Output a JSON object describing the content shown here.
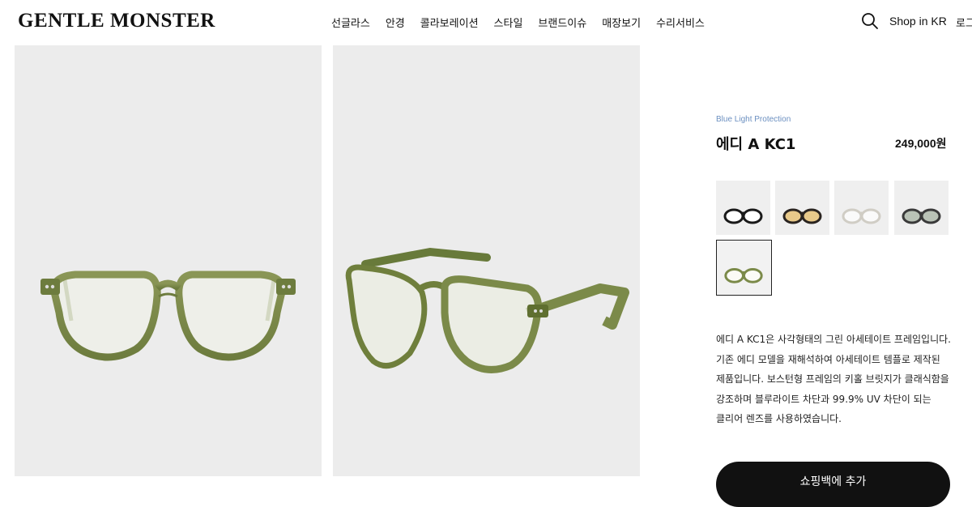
{
  "header": {
    "logo": "GENTLE MONSTER",
    "nav": [
      "선글라스",
      "안경",
      "콜라보레이션",
      "스타일",
      "브랜드이슈",
      "매장보기",
      "수리서비스"
    ],
    "shop": "Shop in KR",
    "login": "로그"
  },
  "product": {
    "tag": "Blue Light Protection",
    "name": "에디 A KC1",
    "price": "249,000원",
    "description": [
      "에디 A KC1은 사각형태의 그린 아세테이트 프레임입니다.",
      "기존 에디 모델을 재해석하여 아세테이트 템플로 제작된",
      "제품입니다. 보스턴형 프레임의 키홀 브릿지가 클래식함을",
      "강조하며 블루라이트 차단과 99.9% UV 차단이 되는",
      "클리어 렌즈를 사용하였습니다."
    ],
    "cta": "쇼핑백에 추가",
    "swatches": [
      {
        "color": "#1a1a1a",
        "lens": "#ffffff"
      },
      {
        "color": "#2a2420",
        "lens": "#e8c98a"
      },
      {
        "color": "#d9d6cf",
        "lens": "#ffffff"
      },
      {
        "color": "#3a3a3a",
        "lens": "#b9c2b6"
      },
      {
        "color": "#7a8550",
        "lens": "#ffffff"
      }
    ]
  },
  "colors": {
    "frame_green": "#7b8a49",
    "frame_dark_green": "#5b6a35",
    "accent": "#6b8fc0"
  }
}
